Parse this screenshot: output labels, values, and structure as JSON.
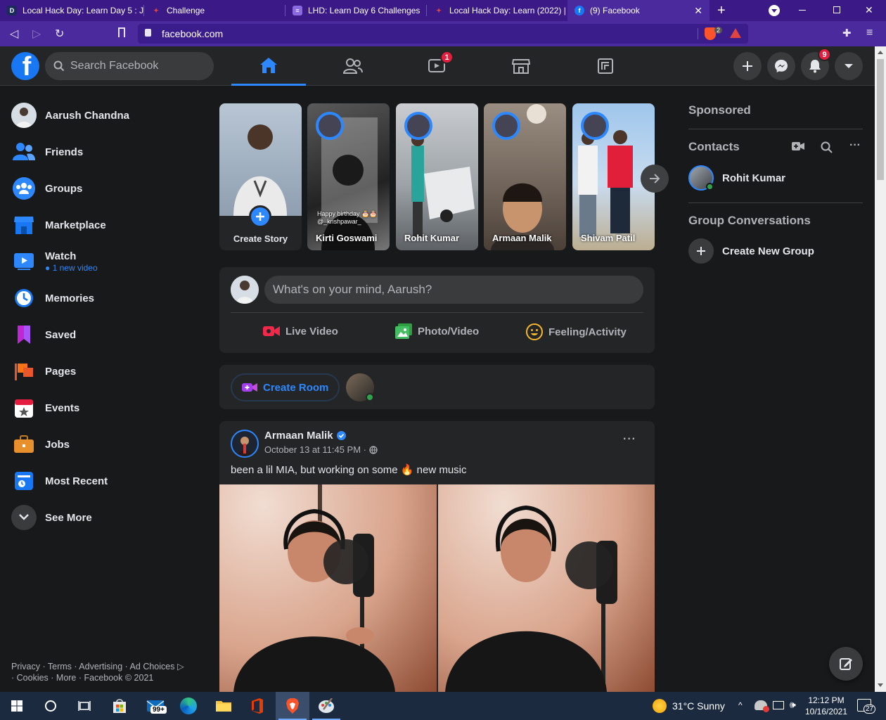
{
  "browser": {
    "tabs": [
      {
        "title": "Local Hack Day: Learn Day 5 : J",
        "favicon": "D"
      },
      {
        "title": "Challenge",
        "favicon": "mlh"
      },
      {
        "title": "LHD: Learn Day 6 Challenges",
        "favicon": "doc"
      },
      {
        "title": "Local Hack Day: Learn (2022) |",
        "favicon": "mlh"
      },
      {
        "title": "(9) Facebook",
        "favicon": "f"
      }
    ],
    "url": "facebook.com",
    "brave_badge": "2"
  },
  "header": {
    "search_placeholder": "Search Facebook",
    "watch_badge": "1",
    "notifications_badge": "9"
  },
  "sidebar": {
    "items": [
      {
        "label": "Aarush Chandna",
        "icon": "profile-avatar"
      },
      {
        "label": "Friends",
        "icon": "friends-icon"
      },
      {
        "label": "Groups",
        "icon": "groups-icon"
      },
      {
        "label": "Marketplace",
        "icon": "marketplace-icon"
      },
      {
        "label": "Watch",
        "icon": "watch-icon",
        "sub": "1 new video"
      },
      {
        "label": "Memories",
        "icon": "memories-icon"
      },
      {
        "label": "Saved",
        "icon": "saved-icon"
      },
      {
        "label": "Pages",
        "icon": "pages-icon"
      },
      {
        "label": "Events",
        "icon": "events-icon"
      },
      {
        "label": "Jobs",
        "icon": "jobs-icon"
      },
      {
        "label": "Most Recent",
        "icon": "most-recent-icon"
      },
      {
        "label": "See More",
        "icon": "chevron-down-icon"
      }
    ],
    "footer_line1": "Privacy · Terms · Advertising · Ad Choices",
    "footer_line2": "· Cookies · More · Facebook © 2021"
  },
  "stories": {
    "create_label": "Create Story",
    "items": [
      {
        "name": "Kirti Goswami",
        "caption": "Happy birthday 🎂🎂 @_krishpawar_"
      },
      {
        "name": "Rohit Kumar"
      },
      {
        "name": "Armaan Malik"
      },
      {
        "name": "Shivam Patil"
      }
    ]
  },
  "composer": {
    "placeholder": "What's on your mind, Aarush?",
    "live_label": "Live Video",
    "photo_label": "Photo/Video",
    "feeling_label": "Feeling/Activity"
  },
  "room": {
    "create_label": "Create Room"
  },
  "post": {
    "author": "Armaan Malik",
    "time": "October 13 at 11:45 PM ·",
    "text_before": "been a lil MIA, but working on some",
    "emoji": "🔥",
    "text_after": "new music",
    "more": "···"
  },
  "right": {
    "sponsored": "Sponsored",
    "contacts": "Contacts",
    "contact_name": "Rohit Kumar",
    "group_conversations": "Group Conversations",
    "create_group": "Create New Group",
    "more": "···"
  },
  "taskbar": {
    "mail_badge": "99+",
    "weather": "31°C  Sunny",
    "time": "12:12 PM",
    "date": "10/16/2021",
    "notif_count": "27"
  },
  "colors": {
    "accent": "#2d88ff",
    "fb_blue": "#1877f2",
    "badge_red": "#e41e3f",
    "bg": "#18191a",
    "surface": "#242526"
  }
}
